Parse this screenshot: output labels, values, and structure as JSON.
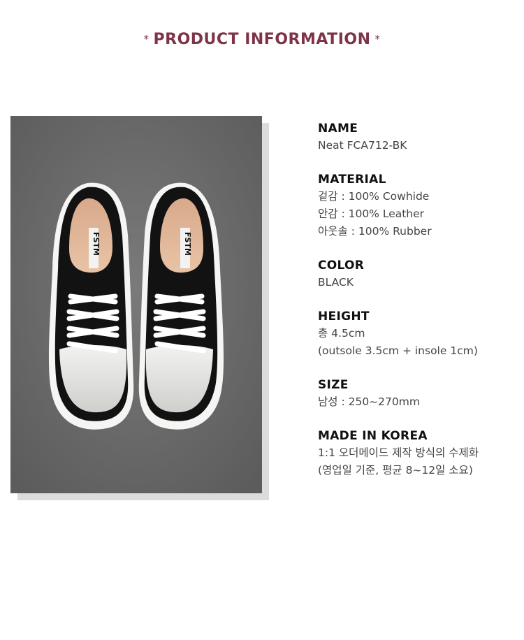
{
  "header": {
    "title": "PRODUCT INFORMATION",
    "star": "*"
  },
  "product": {
    "image_text": "FSTM",
    "fields": [
      {
        "label": "NAME",
        "values": [
          "Neat FCA712-BK"
        ]
      },
      {
        "label": "MATERIAL",
        "values": [
          "겉감 : 100% Cowhide",
          "안감 : 100% Leather",
          "아웃솔 : 100% Rubber"
        ]
      },
      {
        "label": "COLOR",
        "values": [
          "BLACK"
        ]
      },
      {
        "label": "HEIGHT",
        "values": [
          "총 4.5cm",
          "(outsole 3.5cm + insole 1cm)"
        ]
      },
      {
        "label": "SIZE",
        "values": [
          "남성 : 250~270mm"
        ]
      },
      {
        "label": "MADE IN KOREA",
        "values": [
          "1:1 오더메이드 제작 방식의 수제화",
          "(영업일 기준, 평균 8~12일 소요)"
        ]
      }
    ]
  },
  "colors": {
    "accent": "#7e3448",
    "shoe": "#111111",
    "toecap": "#e4e4e2"
  }
}
